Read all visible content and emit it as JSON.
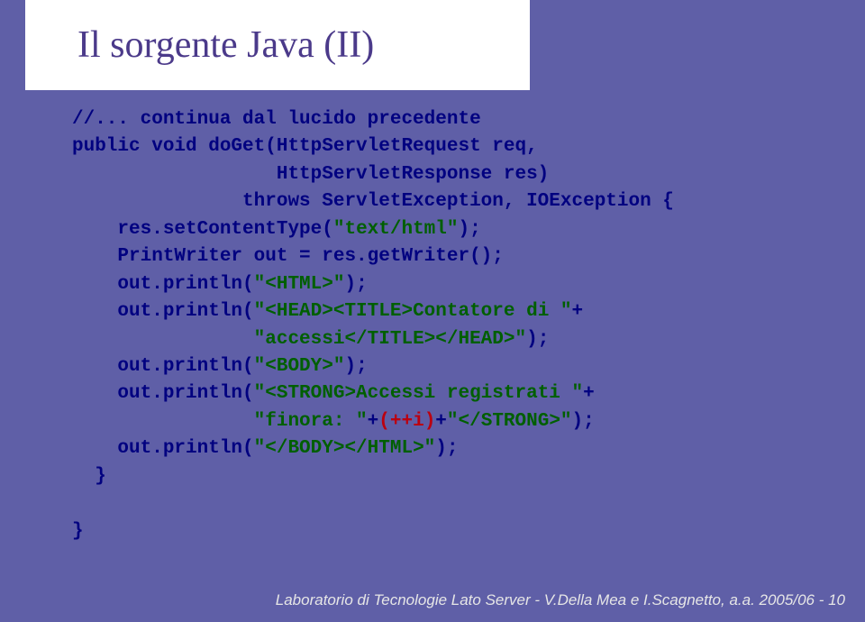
{
  "title": "Il sorgente Java (II)",
  "code": {
    "l1": "//... continua dal lucido precedente",
    "l2": "public void doGet(HttpServletRequest req,",
    "l3": "                  HttpServletResponse res)",
    "l4": "               throws ServletException, IOException {",
    "l5a": "    res.setContentType(",
    "l5b": "\"text/html\"",
    "l5c": ");",
    "l6": "    PrintWriter out = res.getWriter();",
    "l7a": "    out.println(",
    "l7b": "\"<HTML>\"",
    "l7c": ");",
    "l8a": "    out.println(",
    "l8b": "\"<HEAD><TITLE>Contatore di \"",
    "l8c": "+",
    "l9a": "                ",
    "l9b": "\"accessi</TITLE></HEAD>\"",
    "l9c": ");",
    "l10a": "    out.println(",
    "l10b": "\"<BODY>\"",
    "l10c": ");",
    "l11a": "    out.println(",
    "l11b": "\"<STRONG>Accessi registrati \"",
    "l11c": "+",
    "l12a": "                ",
    "l12b": "\"finora: \"",
    "l12c": "+",
    "l12d": "(++i)",
    "l12e": "+",
    "l12f": "\"</STRONG>\"",
    "l12g": ");",
    "l13a": "    out.println(",
    "l13b": "\"</BODY></HTML>\"",
    "l13c": ");",
    "l14": "  }",
    "l15": "}"
  },
  "footer": "Laboratorio di Tecnologie Lato Server - V.Della Mea e I.Scagnetto, a.a. 2005/06 - 10"
}
